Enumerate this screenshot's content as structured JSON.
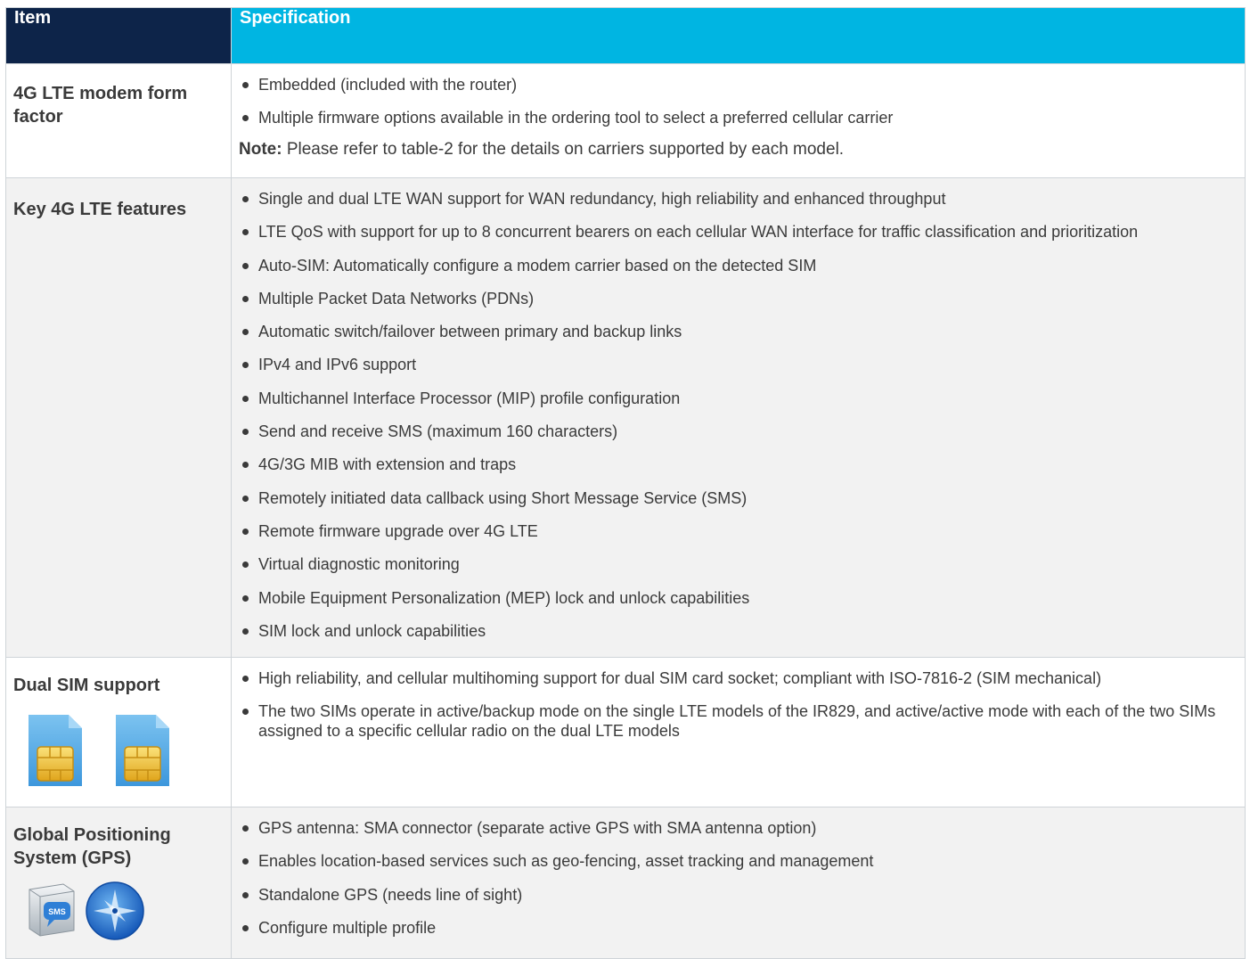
{
  "header": {
    "item": "Item",
    "specification": "Specification"
  },
  "rows": [
    {
      "item": "4G LTE modem form factor",
      "bullets": [
        "Embedded (included with the router)",
        "Multiple firmware options available in the ordering tool to select a preferred cellular carrier"
      ],
      "note_label": "Note:",
      "note_text": " Please refer to table-2 for the details on carriers supported by each model."
    },
    {
      "item": "Key 4G LTE features",
      "bullets": [
        "Single and dual LTE WAN support for WAN redundancy, high reliability and enhanced throughput",
        "LTE QoS with support for up to 8 concurrent bearers on each cellular WAN interface for traffic classification and prioritization",
        "Auto-SIM: Automatically configure a modem carrier based on the detected SIM",
        "Multiple Packet Data Networks (PDNs)",
        "Automatic switch/failover between primary and backup links",
        "IPv4 and IPv6 support",
        "Multichannel Interface Processor (MIP) profile configuration",
        "Send and receive SMS (maximum 160 characters)",
        "4G/3G MIB with extension and traps",
        "Remotely initiated data callback using Short Message Service (SMS)",
        "Remote firmware upgrade over 4G LTE",
        "Virtual diagnostic monitoring",
        "Mobile Equipment Personalization (MEP) lock and unlock capabilities",
        "SIM lock and unlock capabilities"
      ]
    },
    {
      "item": "Dual SIM support",
      "bullets": [
        "High reliability, and cellular multihoming support for dual SIM card socket; compliant with ISO-7816-2 (SIM mechanical)",
        "The two SIMs operate in active/backup mode on the single LTE models of the IR829, and active/active mode with each of the two SIMs assigned to a specific cellular radio on the dual LTE models"
      ],
      "icons": [
        "sim-card-icon",
        "sim-card-icon"
      ]
    },
    {
      "item": "Global Positioning System (GPS)",
      "bullets": [
        "GPS antenna: SMA connector (separate active GPS with SMA antenna option)",
        "Enables location-based services such as geo-fencing, asset tracking and management",
        "Standalone GPS (needs line of sight)",
        "Configure multiple profile"
      ],
      "icons": [
        "sms-icon",
        "compass-icon"
      ],
      "sms_badge": "SMS"
    }
  ],
  "colors": {
    "header_item": "#0d2449",
    "header_spec": "#00b5e2",
    "row_shade": "#f2f2f2",
    "sim": "#5aaee6",
    "chip": "#f2c230"
  }
}
